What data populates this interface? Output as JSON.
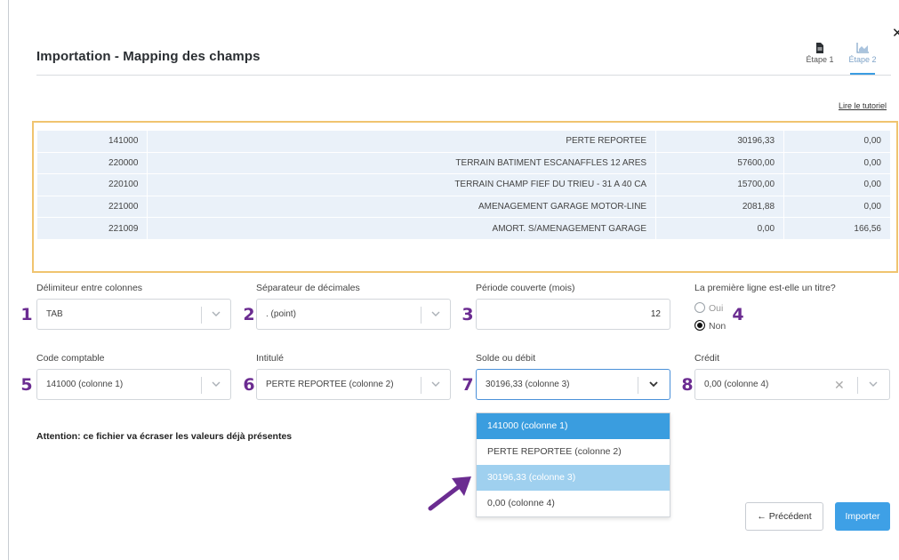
{
  "dialog": {
    "title": "Importation - Mapping des champs",
    "close_icon": "close-icon",
    "steps": [
      {
        "label": "Étape 1",
        "icon": "document-icon",
        "active": false
      },
      {
        "label": "Étape 2",
        "icon": "chart-icon",
        "active": true
      }
    ],
    "tutorial_link": "Lire le tutoriel"
  },
  "preview": {
    "rows": [
      [
        "141000",
        "PERTE REPORTEE",
        "30196,33",
        "0,00"
      ],
      [
        "220000",
        "TERRAIN BATIMENT ESCANAFFLES 12 ARES",
        "57600,00",
        "0,00"
      ],
      [
        "220100",
        "TERRAIN CHAMP FIEF DU TRIEU - 31 A 40 CA",
        "15700,00",
        "0,00"
      ],
      [
        "221000",
        "AMENAGEMENT GARAGE MOTOR-LINE",
        "2081,88",
        "0,00"
      ],
      [
        "221009",
        "AMORT. S/AMENAGEMENT GARAGE",
        "0,00",
        "166,56"
      ]
    ],
    "highlight_color": "#f0c46f"
  },
  "settings": {
    "delimiter": {
      "label": "Délimiteur entre colonnes",
      "value": "TAB",
      "badge": "1"
    },
    "decimal": {
      "label": "Séparateur de décimales",
      "value": ". (point)",
      "badge": "2"
    },
    "period": {
      "label": "Période couverte (mois)",
      "value": "12",
      "badge": "3"
    },
    "first_line": {
      "label": "La première ligne est-elle un titre?",
      "options": [
        "Oui",
        "Non"
      ],
      "selected": "Non",
      "badge": "4"
    }
  },
  "mapping": {
    "code": {
      "label": "Code comptable",
      "value": "141000 (colonne 1)",
      "badge": "5"
    },
    "intitule": {
      "label": "Intitulé",
      "value": "PERTE REPORTEE (colonne 2)",
      "badge": "6"
    },
    "solde": {
      "label": "Solde ou débit",
      "value": "30196,33 (colonne 3)",
      "badge": "7"
    },
    "credit": {
      "label": "Crédit",
      "value": "0,00 (colonne 4)",
      "badge": "8"
    }
  },
  "dropdown": {
    "options": [
      "141000 (colonne 1)",
      "PERTE REPORTEE (colonne 2)",
      "30196,33 (colonne 3)",
      "0,00 (colonne 4)"
    ],
    "selected_index": 0,
    "hover_index": 2
  },
  "warning": "Attention: ce fichier va écraser les valeurs déjà présentes",
  "buttons": {
    "previous": "Précédent",
    "import": "Importer"
  },
  "colors": {
    "accent": "#3ea0e6",
    "badge": "#6b2c91",
    "table_bg": "#eaf1f9"
  }
}
